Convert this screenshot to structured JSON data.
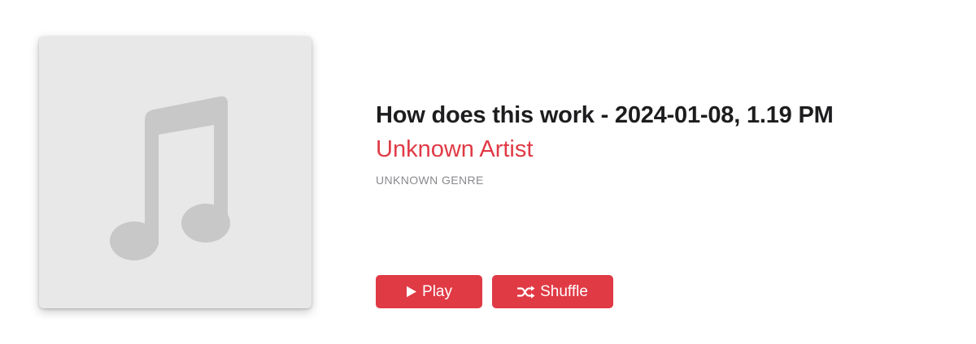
{
  "album": {
    "title": "How does this work - 2024-01-08, 1.19 PM",
    "artist": "Unknown Artist",
    "genre": "UNKNOWN GENRE",
    "artwork_icon": "music-note-icon"
  },
  "actions": {
    "play_label": "Play",
    "play_icon": "play-icon",
    "shuffle_label": "Shuffle",
    "shuffle_icon": "shuffle-icon"
  },
  "colors": {
    "accent": "#e03a45",
    "artwork_bg": "#e8e8e8",
    "artwork_glyph": "#c8c8c8",
    "title_text": "#1d1d1f",
    "genre_text": "#8a8a8e"
  }
}
